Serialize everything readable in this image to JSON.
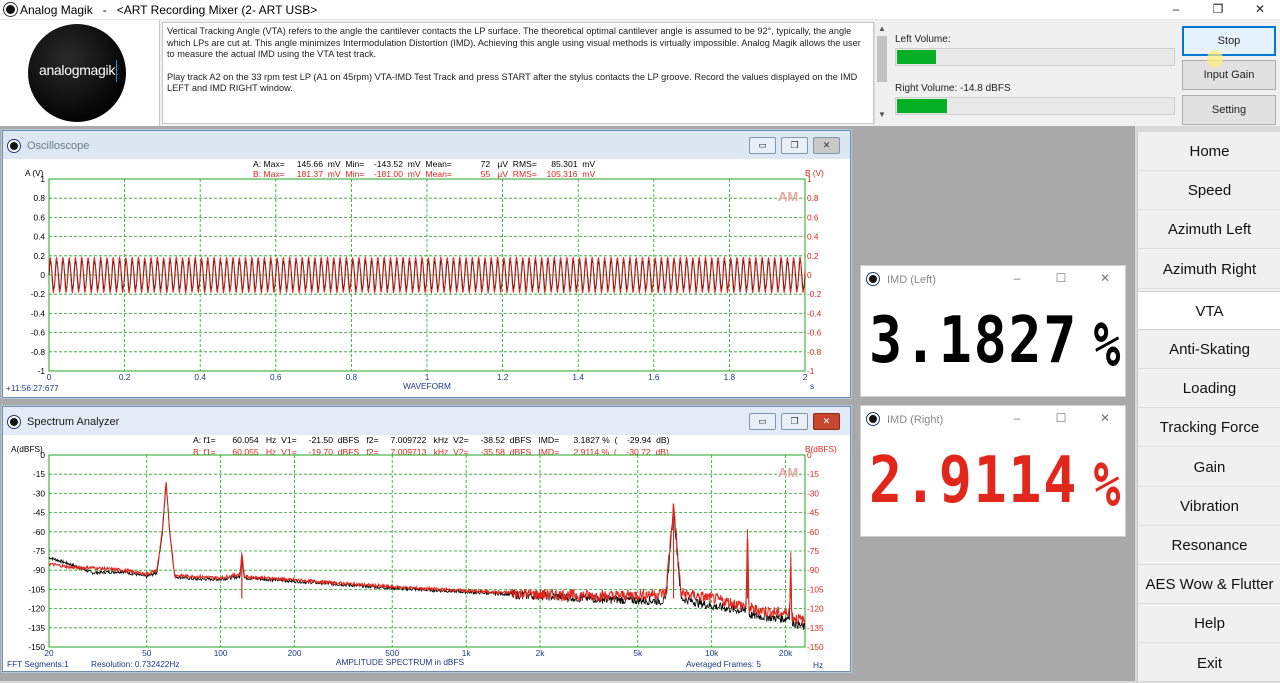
{
  "window": {
    "title": "Analog Magik   -   <ART Recording Mixer (2- ART USB>",
    "minimize": "–",
    "restore": "❐",
    "close": "✕"
  },
  "logo": {
    "text": "analogmagik"
  },
  "instructions": {
    "p1": "Vertical Tracking Angle (VTA) refers to the angle the cantilever contacts the LP surface.  The theoretical optimal cantilever angle is assumed to be 92°, typically, the angle which LPs are cut at.  This angle minimizes Intermodulation Distortion (IMD).  Achieving this angle using visual methods is virtually impossible.  Analog Magik allows the user to measure the actual IMD using the VTA test track.",
    "p2": "Play track A2 on the 33 rpm test LP (A1 on 45rpm) VTA-IMD Test Track and press START after the stylus contacts the LP groove.  Record the values displayed on the IMD LEFT and IMD RIGHT window."
  },
  "volume": {
    "left_label": "Left Volume:",
    "left_level": 0.14,
    "right_label": "Right Volume:  -14.8 dBFS",
    "right_level": 0.18
  },
  "buttons": {
    "stop": "Stop",
    "input_gain": "Input Gain",
    "setting": "Setting"
  },
  "oscilloscope": {
    "title": "Oscilloscope",
    "readout_a": "A: Max=     145.66  mV  Min=    -143.52  mV  Mean=            72   µV  RMS=      85.301  mV",
    "readout_b": "B: Max=     181.37  mV  Min=    -181.00  mV  Mean=            55   µV  RMS=    105.316  mV",
    "timestamp": "+11:56:27:677"
  },
  "spectrum": {
    "title": "Spectrum Analyzer",
    "readout_a": "A: f1=       60.054   Hz  V1=     -21.50  dBFS   f2=     7.009722   kHz  V2=     -38.52  dBFS   IMD=      3.1827 %  (    -29.94  dB)",
    "readout_b": "B: f1=       60.055   Hz  V1=     -19.70  dBFS   f2=     7.009713   kHz  V2=     -35.58  dBFS   IMD=      2.9114 %  (    -30.72  dB)",
    "fft_segments": "FFT  Segments:1",
    "resolution": "Resolution:  0.732422Hz",
    "averaged": "Averaged Frames:  5"
  },
  "chart_data": [
    {
      "type": "line",
      "title": "",
      "xlabel": "WAVEFORM",
      "x_unit": "s",
      "ylabel_left": "A (V)",
      "ylabel_right": "B (V)",
      "xlim": [
        0,
        2
      ],
      "ylim": [
        -1,
        1
      ],
      "x_ticks": [
        "0",
        "0.2",
        "0.4",
        "0.6",
        "0.8",
        "1",
        "1.2",
        "1.4",
        "1.6",
        "1.8",
        "2"
      ],
      "y_ticks_left": [
        "1",
        "0.8",
        "0.6",
        "0.4",
        "0.2",
        "0",
        "-0.2",
        "-0.4",
        "-0.6",
        "-0.8",
        "-1"
      ],
      "y_ticks_right": [
        "1",
        "0.8",
        "0.6",
        "0.4",
        "0.2",
        "0",
        "-0.2",
        "-0.4",
        "-0.6",
        "-0.8",
        "-1"
      ],
      "watermark": "AM",
      "grid": true,
      "series": [
        {
          "color": "#000000",
          "amplitude": 0.1457,
          "cycles": 120
        },
        {
          "color": "#e1261c",
          "amplitude": 0.1814,
          "cycles": 120
        }
      ],
      "colors": {
        "a": "#000000",
        "b": "#e1261c",
        "grid": "#22a722"
      }
    },
    {
      "type": "line",
      "title": "",
      "xlabel": "AMPLITUDE SPECTRUM in dBFS",
      "x_unit": "Hz",
      "ylabel_left": "A(dBFS)",
      "ylabel_right": "B(dBFS)",
      "x_scale": "log",
      "xlim": [
        20,
        24000
      ],
      "ylim": [
        -150,
        0
      ],
      "x_ticks": [
        {
          "v": 20,
          "t": "20"
        },
        {
          "v": 50,
          "t": "50"
        },
        {
          "v": 100,
          "t": "100"
        },
        {
          "v": 200,
          "t": "200"
        },
        {
          "v": 500,
          "t": "500"
        },
        {
          "v": 1000,
          "t": "1k"
        },
        {
          "v": 2000,
          "t": "2k"
        },
        {
          "v": 5000,
          "t": "5k"
        },
        {
          "v": 10000,
          "t": "10k"
        },
        {
          "v": 20000,
          "t": "20k"
        }
      ],
      "y_ticks": [
        "0",
        "-15",
        "-30",
        "-45",
        "-60",
        "-75",
        "-90",
        "-105",
        "-120",
        "-135",
        "-150"
      ],
      "watermark": "AM",
      "grid": true,
      "series": [
        {
          "color": "#000000",
          "points": [
            [
              20,
              -80
            ],
            [
              25,
              -86
            ],
            [
              30,
              -92
            ],
            [
              40,
              -91
            ],
            [
              50,
              -95
            ],
            [
              55,
              -92
            ],
            [
              58,
              -60
            ],
            [
              60,
              -22
            ],
            [
              62,
              -60
            ],
            [
              65,
              -95
            ],
            [
              80,
              -97
            ],
            [
              100,
              -97
            ],
            [
              120,
              -95
            ],
            [
              122,
              -80
            ],
            [
              125,
              -96
            ],
            [
              180,
              -98
            ],
            [
              300,
              -101
            ],
            [
              500,
              -104
            ],
            [
              1000,
              -107
            ],
            [
              2000,
              -110
            ],
            [
              4000,
              -113
            ],
            [
              6500,
              -114
            ],
            [
              7000,
              -42
            ],
            [
              7500,
              -112
            ],
            [
              10000,
              -118
            ],
            [
              13800,
              -122
            ],
            [
              14000,
              -60
            ],
            [
              14200,
              -125
            ],
            [
              20000,
              -128
            ],
            [
              20800,
              -125
            ],
            [
              21000,
              -80
            ],
            [
              21200,
              -130
            ],
            [
              24000,
              -135
            ]
          ]
        },
        {
          "color": "#e1261c",
          "points": [
            [
              20,
              -85
            ],
            [
              25,
              -88
            ],
            [
              30,
              -88
            ],
            [
              40,
              -90
            ],
            [
              50,
              -93
            ],
            [
              55,
              -90
            ],
            [
              58,
              -58
            ],
            [
              60,
              -20
            ],
            [
              62,
              -58
            ],
            [
              65,
              -94
            ],
            [
              80,
              -95
            ],
            [
              100,
              -96
            ],
            [
              120,
              -93
            ],
            [
              122,
              -76
            ],
            [
              125,
              -95
            ],
            [
              180,
              -97
            ],
            [
              300,
              -100
            ],
            [
              500,
              -103
            ],
            [
              1000,
              -106
            ],
            [
              2000,
              -109
            ],
            [
              4000,
              -110
            ],
            [
              6500,
              -108
            ],
            [
              7000,
              -38
            ],
            [
              7500,
              -108
            ],
            [
              10000,
              -112
            ],
            [
              13800,
              -118
            ],
            [
              14000,
              -58
            ],
            [
              14200,
              -120
            ],
            [
              20000,
              -124
            ],
            [
              20800,
              -120
            ],
            [
              21000,
              -76
            ],
            [
              21200,
              -126
            ],
            [
              24000,
              -130
            ]
          ]
        }
      ],
      "colors": {
        "grid": "#22a722"
      }
    }
  ],
  "imd_left": {
    "title": "IMD (Left)",
    "value": "3.1827",
    "unit": "%",
    "color": "#000000"
  },
  "imd_right": {
    "title": "IMD (Right)",
    "value": "2.9114",
    "unit": "%",
    "color": "#e1261c"
  },
  "nav": [
    "Home",
    "Speed",
    "Azimuth Left",
    "Azimuth Right",
    "VTA",
    "Anti-Skating",
    "Loading",
    "Tracking Force",
    "Gain",
    "Vibration",
    "Resonance",
    "AES Wow & Flutter",
    "Help",
    "Exit"
  ],
  "nav_selected": "VTA"
}
